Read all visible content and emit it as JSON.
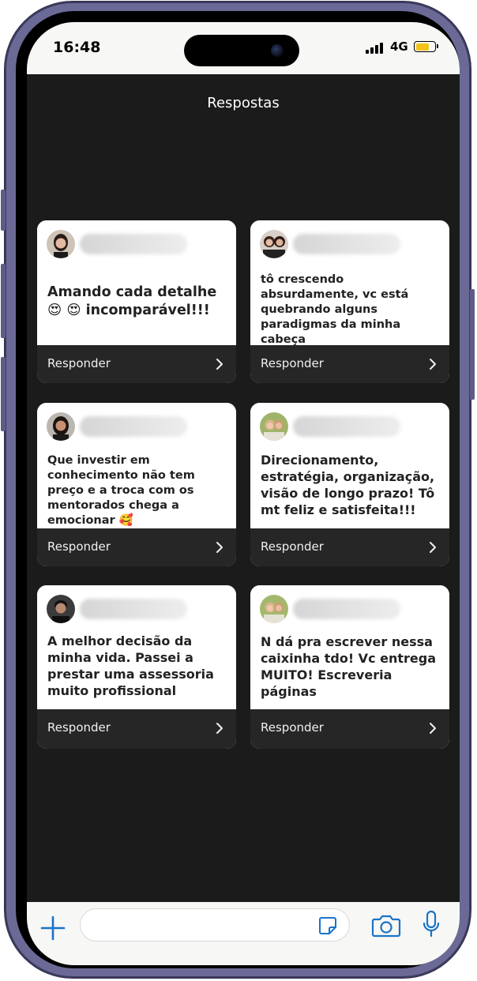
{
  "status_bar": {
    "time": "16:48",
    "network": "4G"
  },
  "header": {
    "title": "Respostas"
  },
  "cards": [
    {
      "message": "Amando cada detalhe 😍 😍 incomparável!!!",
      "reply_label": "Responder"
    },
    {
      "message": "tô crescendo absurdamente, vc está quebrando alguns paradigmas da minha cabeça",
      "reply_label": "Responder"
    },
    {
      "message": "Que investir em conhecimento não tem preço e a troca com os mentorados chega a emocionar 🥰",
      "reply_label": "Responder"
    },
    {
      "message": "Direcionamento, estratégia, organização, visão de longo prazo! Tô mt feliz e satisfeita!!!",
      "reply_label": "Responder"
    },
    {
      "message": "A melhor decisão da minha vida. Passei a prestar uma assessoria muito profissional",
      "reply_label": "Responder"
    },
    {
      "message": "N dá pra escrever nessa caixinha tdo! Vc entrega MUITO! Escreveria páginas",
      "reply_label": "Responder"
    }
  ],
  "colors": {
    "accent": "#1a73c8",
    "screen_bg": "#1b1b1b",
    "card_footer": "#262626",
    "battery": "#f2c318"
  },
  "icons": [
    "plus-icon",
    "sticker-icon",
    "camera-icon",
    "microphone-icon",
    "chevron-right-icon"
  ]
}
